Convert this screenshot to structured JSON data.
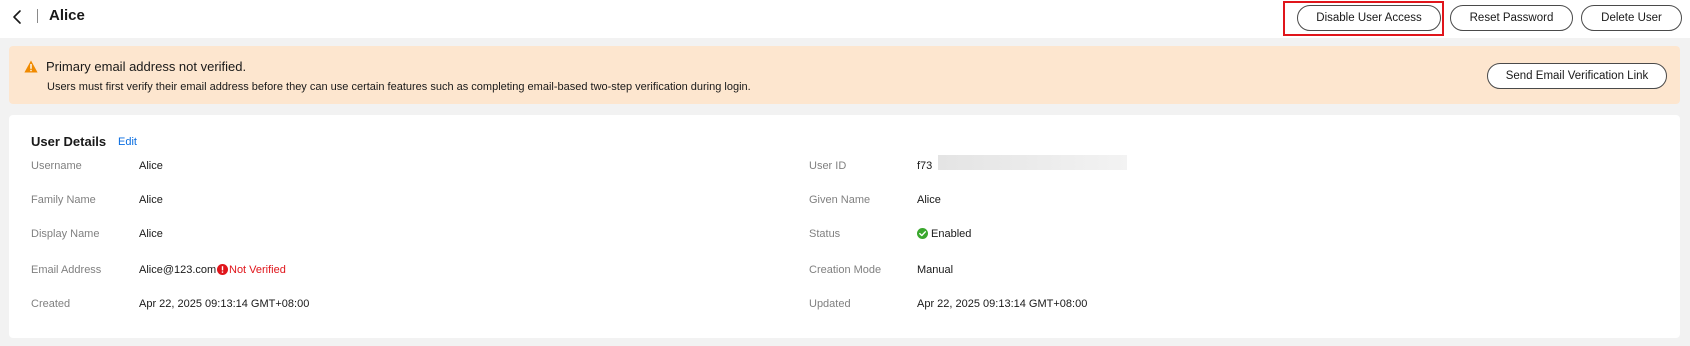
{
  "header": {
    "title": "Alice",
    "buttons": {
      "disable_user_access": "Disable User Access",
      "reset_password": "Reset Password",
      "delete_user": "Delete User"
    }
  },
  "warning": {
    "title": "Primary email address not verified.",
    "message": "Users must first verify their email address before they can use certain features such as completing email-based two-step verification during login.",
    "action_label": "Send Email Verification Link"
  },
  "details": {
    "title": "User Details",
    "edit_label": "Edit",
    "left": [
      {
        "label": "Username",
        "value": "Alice"
      },
      {
        "label": "Family Name",
        "value": "Alice"
      },
      {
        "label": "Display Name",
        "value": "Alice"
      },
      {
        "label": "Email Address",
        "value": "Alice@123.com",
        "badge": "Not Verified"
      },
      {
        "label": "Created",
        "value": "Apr 22, 2025 09:13:14 GMT+08:00"
      }
    ],
    "right": [
      {
        "label": "User ID",
        "value": "f73"
      },
      {
        "label": "Given Name",
        "value": "Alice"
      },
      {
        "label": "Status",
        "value": "Enabled"
      },
      {
        "label": "Creation Mode",
        "value": "Manual"
      },
      {
        "label": "Updated",
        "value": "Apr 22, 2025 09:13:14 GMT+08:00"
      }
    ]
  },
  "colors": {
    "warning_bg": "#fde6cf",
    "warning_icon": "#f08a00",
    "link": "#0a6de0",
    "error": "#e0151b",
    "success": "#3aa72d",
    "highlight_box": "#e0151b"
  },
  "icons": {
    "back": "chevron-left-icon",
    "warning": "warning-triangle-icon",
    "status_enabled": "check-circle-icon",
    "email_error": "error-circle-icon"
  }
}
